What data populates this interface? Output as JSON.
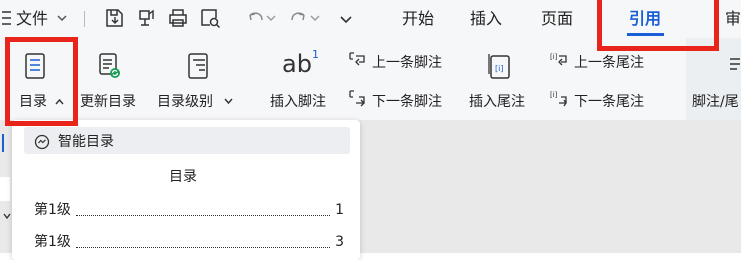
{
  "menubar": {
    "file_label": "文件",
    "tabs": [
      {
        "label": "开始"
      },
      {
        "label": "插入"
      },
      {
        "label": "页面"
      },
      {
        "label": "引用"
      },
      {
        "label": "审"
      }
    ],
    "active_tab": "引用",
    "active_color": "#1a5fd8"
  },
  "ribbon": {
    "toc_label": "目录",
    "update_toc_label": "更新目录",
    "toc_level_label": "目录级别",
    "insert_footnote_label": "插入脚注",
    "prev_footnote_label": "上一条脚注",
    "next_footnote_label": "下一条脚注",
    "insert_endnote_label": "插入尾注",
    "prev_endnote_label": "上一条尾注",
    "next_endnote_label": "下一条尾注",
    "footnote_endnote_label": "脚注/尾",
    "ab_icon_text": "ab",
    "ab_superscript": "1"
  },
  "toc_panel": {
    "smart_toc_label": "智能目录",
    "preview_title": "目录",
    "entries": [
      {
        "label": "第1级",
        "page": "1"
      },
      {
        "label": "第1级",
        "page": "3"
      }
    ]
  },
  "colors": {
    "highlight_box": "#e8241b",
    "accent_blue": "#1a5fd8",
    "icon_green": "#1e9c5a"
  }
}
